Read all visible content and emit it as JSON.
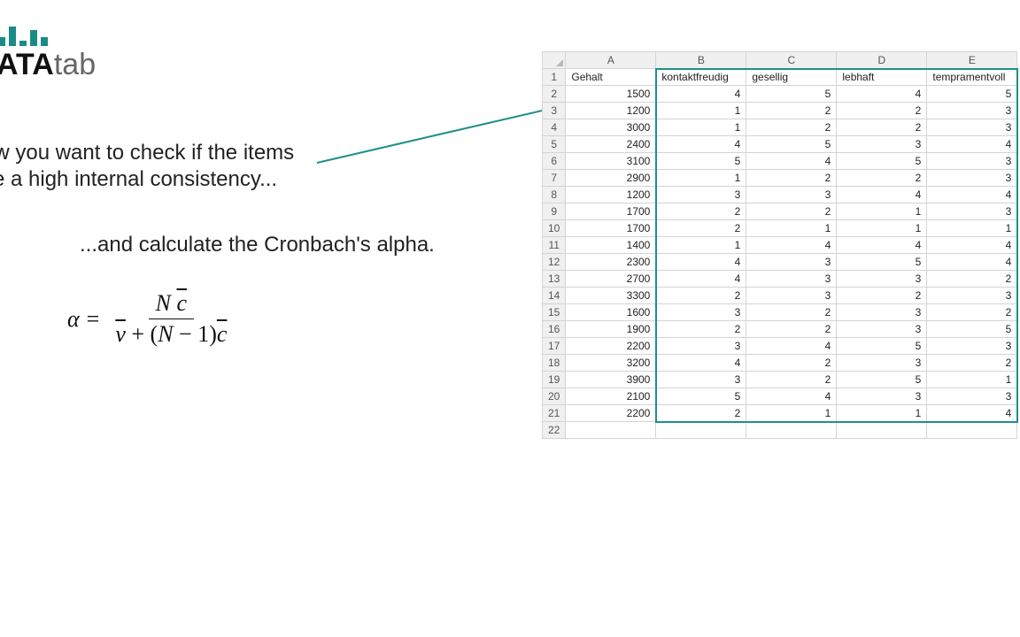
{
  "logo": {
    "brand_bold": "ATA",
    "brand_light": "tab"
  },
  "text": {
    "line1a": "ow you want to check if the items",
    "line1b": "ve a high internal consistency...",
    "line2": "...and calculate the Cronbach's alpha."
  },
  "formula": {
    "alpha": "α",
    "eq": "=",
    "num": "N c̄",
    "den": "v̄ + (N − 1)c̄"
  },
  "sheet": {
    "columns": [
      "A",
      "B",
      "C",
      "D",
      "E"
    ],
    "headers": [
      "Gehalt",
      "kontaktfreudig",
      "gesellig",
      "lebhaft",
      "tempramentvoll"
    ],
    "rows": [
      {
        "n": 1
      },
      {
        "n": 2,
        "cells": [
          "1500",
          "4",
          "5",
          "4",
          "5"
        ]
      },
      {
        "n": 3,
        "cells": [
          "1200",
          "1",
          "2",
          "2",
          "3"
        ]
      },
      {
        "n": 4,
        "cells": [
          "3000",
          "1",
          "2",
          "2",
          "3"
        ]
      },
      {
        "n": 5,
        "cells": [
          "2400",
          "4",
          "5",
          "3",
          "4"
        ]
      },
      {
        "n": 6,
        "cells": [
          "3100",
          "5",
          "4",
          "5",
          "3"
        ]
      },
      {
        "n": 7,
        "cells": [
          "2900",
          "1",
          "2",
          "2",
          "3"
        ]
      },
      {
        "n": 8,
        "cells": [
          "1200",
          "3",
          "3",
          "4",
          "4"
        ]
      },
      {
        "n": 9,
        "cells": [
          "1700",
          "2",
          "2",
          "1",
          "3"
        ]
      },
      {
        "n": 10,
        "cells": [
          "1700",
          "2",
          "1",
          "1",
          "1"
        ]
      },
      {
        "n": 11,
        "cells": [
          "1400",
          "1",
          "4",
          "4",
          "4"
        ]
      },
      {
        "n": 12,
        "cells": [
          "2300",
          "4",
          "3",
          "5",
          "4"
        ]
      },
      {
        "n": 13,
        "cells": [
          "2700",
          "4",
          "3",
          "3",
          "2"
        ]
      },
      {
        "n": 14,
        "cells": [
          "3300",
          "2",
          "3",
          "2",
          "3"
        ]
      },
      {
        "n": 15,
        "cells": [
          "1600",
          "3",
          "2",
          "3",
          "2"
        ]
      },
      {
        "n": 16,
        "cells": [
          "1900",
          "2",
          "2",
          "3",
          "5"
        ]
      },
      {
        "n": 17,
        "cells": [
          "2200",
          "3",
          "4",
          "5",
          "3"
        ]
      },
      {
        "n": 18,
        "cells": [
          "3200",
          "4",
          "2",
          "3",
          "2"
        ]
      },
      {
        "n": 19,
        "cells": [
          "3900",
          "3",
          "2",
          "5",
          "1"
        ]
      },
      {
        "n": 20,
        "cells": [
          "2100",
          "5",
          "4",
          "3",
          "3"
        ]
      },
      {
        "n": 21,
        "cells": [
          "2200",
          "2",
          "1",
          "1",
          "4"
        ]
      },
      {
        "n": 22
      }
    ]
  }
}
